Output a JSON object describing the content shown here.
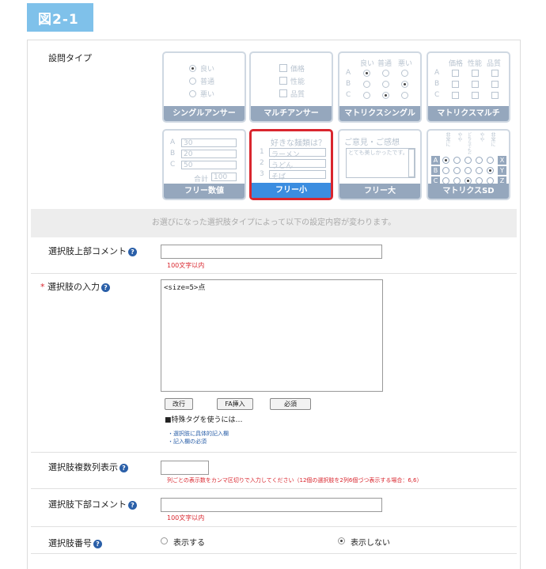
{
  "figure_label": "図2-1",
  "question_type": {
    "label": "設問タイプ",
    "cards": [
      {
        "title": "シングルアンサー",
        "opts": [
          "良い",
          "普通",
          "悪い"
        ]
      },
      {
        "title": "マルチアンサー",
        "opts": [
          "価格",
          "性能",
          "品質"
        ]
      },
      {
        "title": "マトリクスシングル",
        "cols": [
          "良い",
          "普通",
          "悪い"
        ],
        "rows": [
          "A",
          "B",
          "C"
        ]
      },
      {
        "title": "マトリクスマルチ",
        "cols": [
          "価格",
          "性能",
          "品質"
        ],
        "rows": [
          "A",
          "B",
          "C"
        ]
      },
      {
        "title": "フリー数値",
        "rows": [
          "A",
          "B",
          "C"
        ],
        "vals": [
          "30",
          "20",
          "50"
        ],
        "total_label": "合計",
        "total": "100"
      },
      {
        "title": "フリー小",
        "q": "好きな麺類は？",
        "nums": [
          "1",
          "2",
          "3"
        ],
        "vals": [
          "ラーメン",
          "うどん",
          "そば"
        ]
      },
      {
        "title": "フリー大",
        "q": "ご意見・ご感想",
        "sample": "とても美しかったです。"
      },
      {
        "title": "マトリクスSD",
        "left": [
          "A",
          "B",
          "C"
        ],
        "right": [
          "X",
          "Y",
          "Z"
        ],
        "cols": [
          "非常に",
          "やや",
          "どちらでもない",
          "やや",
          "非常に"
        ]
      }
    ]
  },
  "info_bar": "お選びになった選択肢タイプによって以下の設定内容が変わります。",
  "upper_comment": {
    "label": "選択肢上部コメント",
    "note": "100文字以内",
    "value": ""
  },
  "choices": {
    "required_mark": "*",
    "label": "選択肢の入力",
    "value": "<size=5>点",
    "buttons": [
      "改行",
      "FA挿入",
      "必須"
    ],
    "tip_title": "■特殊タグを使うには…",
    "links": [
      "・選択肢に具体的記入欄",
      "・記入欄の必須"
    ]
  },
  "multi_column": {
    "label": "選択肢複数列表示",
    "value": "",
    "note": "列ごとの表示数をカンマ区切りで入力してください（12個の選択肢を2列6個づつ表示する場合：6,6）"
  },
  "lower_comment": {
    "label": "選択肢下部コメント",
    "note": "100文字以内",
    "value": ""
  },
  "choice_number": {
    "label": "選択肢番号",
    "options": [
      "表示する",
      "表示しない"
    ],
    "selected": "表示しない"
  }
}
